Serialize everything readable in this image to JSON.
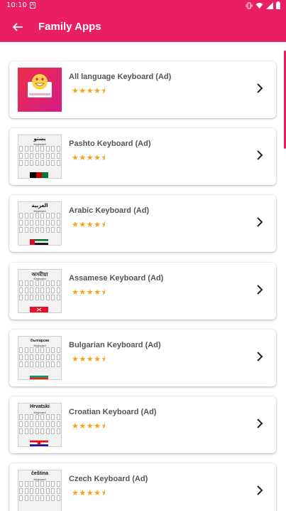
{
  "status_bar": {
    "time": "10:10",
    "notification_icon": "A"
  },
  "app_bar": {
    "title": "Family Apps",
    "back_icon": "arrow-left-icon"
  },
  "colors": {
    "primary": "#e91e63",
    "star": "#f6a21a",
    "chevron": "#222222"
  },
  "apps": [
    {
      "name": "All language Keyboard (Ad)",
      "rating": 4.5,
      "stars": "★★★★⯨",
      "thumb_title": "",
      "thumb_sub": ""
    },
    {
      "name": "Pashto Keyboard (Ad)",
      "rating": 4.5,
      "stars": "★★★★⯨",
      "thumb_title": "پښتو",
      "thumb_sub": "Keyboard"
    },
    {
      "name": "Arabic Keyboard (Ad)",
      "rating": 4.5,
      "stars": "★★★★⯨",
      "thumb_title": "العربية",
      "thumb_sub": "Keyboard"
    },
    {
      "name": "Assamese Keyboard (Ad)",
      "rating": 4.5,
      "stars": "★★★★⯨",
      "thumb_title": "অসমীয়া",
      "thumb_sub": "Keyboard"
    },
    {
      "name": "Bulgarian Keyboard (Ad)",
      "rating": 4.5,
      "stars": "★★★★⯨",
      "thumb_title": "български",
      "thumb_sub": "Keyboard"
    },
    {
      "name": "Croatian Keyboard (Ad)",
      "rating": 4.5,
      "stars": "★★★★⯨",
      "thumb_title": "Hrvatski",
      "thumb_sub": "Keyboard"
    },
    {
      "name": "Czech Keyboard (Ad)",
      "rating": 4.5,
      "stars": "★★★★⯨",
      "thumb_title": "čeština",
      "thumb_sub": "Keyboard"
    }
  ]
}
